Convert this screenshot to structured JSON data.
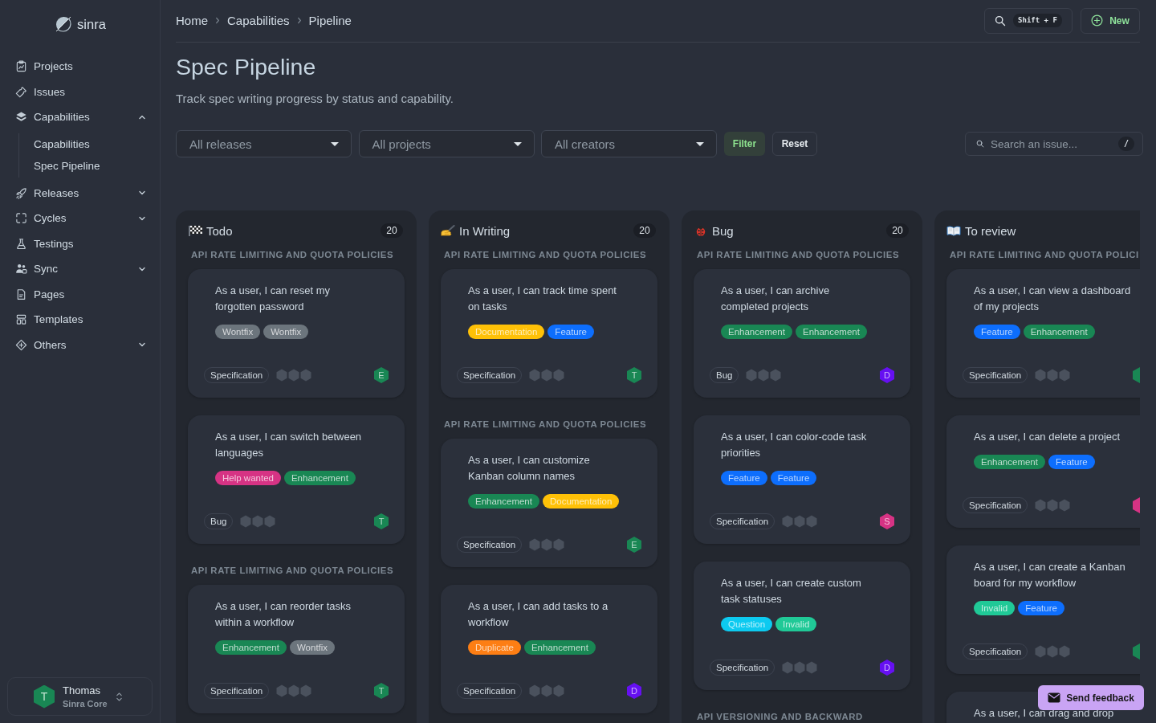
{
  "sidebar": {
    "logo": "sinra",
    "items": [
      {
        "label": "Projects"
      },
      {
        "label": "Issues"
      },
      {
        "label": "Capabilities",
        "expanded": true,
        "children": [
          {
            "label": "Capabilities"
          },
          {
            "label": "Spec Pipeline"
          }
        ]
      },
      {
        "label": "Releases",
        "expanded": false
      },
      {
        "label": "Cycles",
        "expanded": false
      },
      {
        "label": "Testings"
      },
      {
        "label": "Sync",
        "expanded": false
      },
      {
        "label": "Pages"
      },
      {
        "label": "Templates"
      },
      {
        "label": "Others",
        "expanded": false
      }
    ],
    "user": {
      "name": "Thomas",
      "team": "Sinra Core",
      "avatar": "T"
    }
  },
  "breadcrumb": [
    "Home",
    "Capabilities",
    "Pipeline"
  ],
  "toolbar": {
    "search_shortcut": "Shift + F",
    "new_button": "New"
  },
  "header": {
    "title": "Spec Pipeline",
    "subtitle": "Track spec writing progress by status and capability."
  },
  "filters": {
    "selects": [
      "All releases",
      "All projects",
      "All creators"
    ],
    "filter_button": "Filter",
    "reset_button": "Reset",
    "search": {
      "placeholder": "Search an issue...",
      "shortcut": "/"
    }
  },
  "board": {
    "columns": [
      {
        "title": "Todo",
        "count": "20",
        "groups": [
          {
            "label": "API RATE LIMITING AND QUOTA POLICIES",
            "cards": [
              {
                "title": "As a user, I can reset my forgotten password",
                "tags": [
                  {
                    "label": "Wontfix",
                    "color": "#6c757d"
                  },
                  {
                    "label": "Wontfix",
                    "color": "#6c757d"
                  }
                ],
                "category": "Specification",
                "stars": 0,
                "avatar": {
                  "letter": "E",
                  "color": "#198754"
                }
              },
              {
                "title": "As a user, I can switch between languages",
                "tags": [
                  {
                    "label": "Help wanted",
                    "color": "#d63384"
                  },
                  {
                    "label": "Enhancement",
                    "color": "#198754"
                  }
                ],
                "category": "Bug",
                "stars": 0,
                "avatar": {
                  "letter": "T",
                  "color": "#198754"
                }
              }
            ]
          },
          {
            "label": "API RATE LIMITING AND QUOTA POLICIES",
            "cards": [
              {
                "title": "As a user, I can reorder tasks within a workflow",
                "tags": [
                  {
                    "label": "Enhancement",
                    "color": "#198754"
                  },
                  {
                    "label": "Wontfix",
                    "color": "#6c757d"
                  }
                ],
                "category": "Specification",
                "stars": 0,
                "avatar": {
                  "letter": "T",
                  "color": "#198754"
                }
              }
            ]
          }
        ]
      },
      {
        "title": "In Writing",
        "count": "20",
        "groups": [
          {
            "label": "API RATE LIMITING AND QUOTA POLICIES",
            "cards": [
              {
                "title": "As a user, I can track time spent on tasks",
                "tags": [
                  {
                    "label": "Documentation",
                    "color": "#ffc107"
                  },
                  {
                    "label": "Feature",
                    "color": "#0d6efd"
                  }
                ],
                "category": "Specification",
                "stars": 0,
                "avatar": {
                  "letter": "T",
                  "color": "#198754"
                }
              }
            ]
          },
          {
            "label": "API RATE LIMITING AND QUOTA POLICIES",
            "cards": [
              {
                "title": "As a user, I can customize Kanban column names",
                "tags": [
                  {
                    "label": "Enhancement",
                    "color": "#198754"
                  },
                  {
                    "label": "Documentation",
                    "color": "#ffc107"
                  }
                ],
                "category": "Specification",
                "stars": 0,
                "avatar": {
                  "letter": "E",
                  "color": "#198754"
                }
              },
              {
                "title": "As a user, I can add tasks to a workflow",
                "tags": [
                  {
                    "label": "Duplicate",
                    "color": "#fd7e14"
                  },
                  {
                    "label": "Enhancement",
                    "color": "#198754"
                  }
                ],
                "category": "Specification",
                "stars": 0,
                "avatar": {
                  "letter": "D",
                  "color": "#6610f2"
                }
              }
            ]
          }
        ]
      },
      {
        "title": "Bug",
        "count": "20",
        "groups": [
          {
            "label": "API RATE LIMITING AND QUOTA POLICIES",
            "cards": [
              {
                "title": "As a user, I can archive completed projects",
                "tags": [
                  {
                    "label": "Enhancement",
                    "color": "#198754"
                  },
                  {
                    "label": "Enhancement",
                    "color": "#198754"
                  }
                ],
                "category": "Bug",
                "stars": 0,
                "avatar": {
                  "letter": "D",
                  "color": "#6610f2"
                }
              },
              {
                "title": "As a user, I can color-code task priorities",
                "tags": [
                  {
                    "label": "Feature",
                    "color": "#0d6efd"
                  },
                  {
                    "label": "Feature",
                    "color": "#0d6efd"
                  }
                ],
                "category": "Specification",
                "stars": 0,
                "avatar": {
                  "letter": "S",
                  "color": "#d63384"
                }
              },
              {
                "title": "As a user, I can create custom task statuses",
                "tags": [
                  {
                    "label": "Question",
                    "color": "#0dcaf0"
                  },
                  {
                    "label": "Invalid",
                    "color": "#20c997"
                  }
                ],
                "category": "Specification",
                "stars": 0,
                "avatar": {
                  "letter": "D",
                  "color": "#6610f2"
                }
              }
            ]
          },
          {
            "label": "API VERSIONING AND BACKWARD"
          }
        ]
      },
      {
        "title": "To review",
        "groups": [
          {
            "label": "API RATE LIMITING AND QUOTA POLICI",
            "cards": [
              {
                "title": "As a user, I can view a dashboard of my projects",
                "tags": [
                  {
                    "label": "Feature",
                    "color": "#0d6efd"
                  },
                  {
                    "label": "Enhancement",
                    "color": "#198754"
                  }
                ],
                "category": "Specification",
                "stars": 0,
                "avatar": {
                  "color": "#198754"
                }
              },
              {
                "title": "As a user, I can delete a project",
                "tags": [
                  {
                    "label": "Enhancement",
                    "color": "#198754"
                  },
                  {
                    "label": "Feature",
                    "color": "#0d6efd"
                  }
                ],
                "category": "Specification",
                "stars": 0,
                "avatar": {
                  "color": "#d63384"
                }
              },
              {
                "title": "As a user, I can create a Kanban board for my workflow",
                "tags": [
                  {
                    "label": "Invalid",
                    "color": "#20c997"
                  },
                  {
                    "label": "Feature",
                    "color": "#0d6efd"
                  }
                ],
                "category": "Specification",
                "stars": 0,
                "avatar": {
                  "color": "#198754"
                }
              },
              {
                "title": "As a user, I can drag and drop"
              }
            ]
          }
        ]
      }
    ]
  },
  "feedback_button": "Send feedback"
}
